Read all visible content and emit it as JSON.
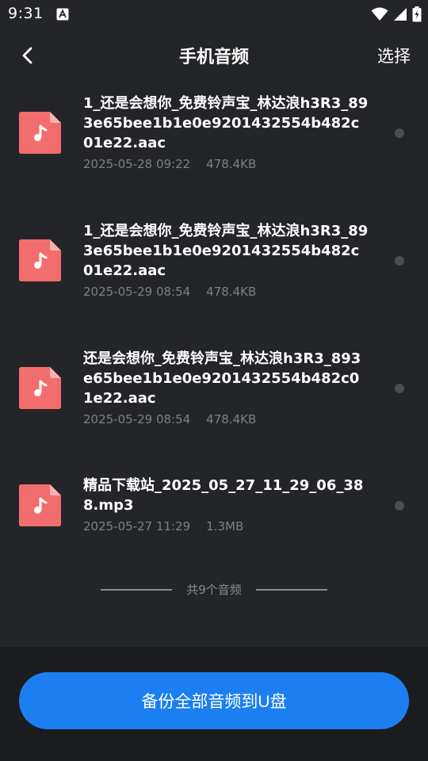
{
  "status_bar": {
    "time": "9:31"
  },
  "header": {
    "title": "手机音频",
    "select_label": "选择"
  },
  "items": [
    {
      "name": "1_还是会想你_免费铃声宝_林达浪h3R3_893e65bee1b1e0e9201432554b482c01e22.aac",
      "date": "2025-05-28 09:22",
      "size": "478.4KB"
    },
    {
      "name": "1_还是会想你_免费铃声宝_林达浪h3R3_893e65bee1b1e0e9201432554b482c01e22.aac",
      "date": "2025-05-29 08:54",
      "size": "478.4KB"
    },
    {
      "name": "还是会想你_免费铃声宝_林达浪h3R3_893e65bee1b1e0e9201432554b482c01e22.aac",
      "date": "2025-05-29 08:54",
      "size": "478.4KB"
    },
    {
      "name": "精品下载站_2025_05_27_11_29_06_388.mp3",
      "date": "2025-05-27 11:29",
      "size": "1.3MB"
    }
  ],
  "footer": {
    "count_text": "共9个音频",
    "backup_label": "备份全部音频到U盘"
  },
  "colors": {
    "background": "#242529",
    "accent": "#1c7ff1",
    "file_icon": "#f26d6d",
    "meta_text": "#7d7f86"
  }
}
